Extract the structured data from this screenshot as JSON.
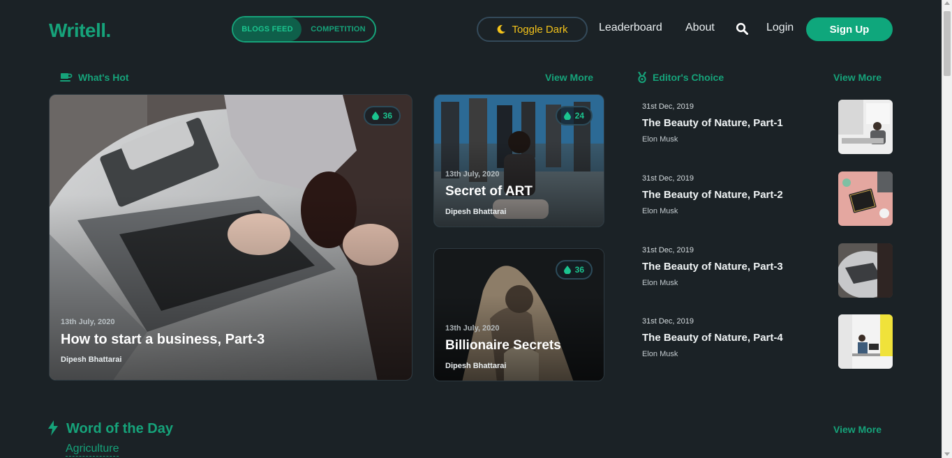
{
  "header": {
    "logo": "Writell.",
    "feed_tabs": [
      "BLOGS FEED",
      "COMPETITION"
    ],
    "toggle_dark": "Toggle Dark",
    "nav": [
      "Leaderboard",
      "About"
    ],
    "login": "Login",
    "signup": "Sign Up"
  },
  "whats_hot": {
    "heading": "What's Hot",
    "view_more": "View More",
    "cards": [
      {
        "date": "13th July, 2020",
        "title": "How to start a business, Part-3",
        "author": "Dipesh Bhattarai",
        "count": "36"
      },
      {
        "date": "13th July, 2020",
        "title": "Secret of ART",
        "author": "Dipesh Bhattarai",
        "count": "24"
      },
      {
        "date": "13th July, 2020",
        "title": "Billionaire Secrets",
        "author": "Dipesh Bhattarai",
        "count": "36"
      }
    ]
  },
  "editors_choice": {
    "heading": "Editor's Choice",
    "view_more": "View More",
    "items": [
      {
        "date": "31st Dec, 2019",
        "title": "The Beauty of Nature, Part-1",
        "author": "Elon Musk"
      },
      {
        "date": "31st Dec, 2019",
        "title": "The Beauty of Nature, Part-2",
        "author": "Elon Musk"
      },
      {
        "date": "31st Dec, 2019",
        "title": "The Beauty of Nature, Part-3",
        "author": "Elon Musk"
      },
      {
        "date": "31st Dec, 2019",
        "title": "The Beauty of Nature, Part-4",
        "author": "Elon Musk"
      }
    ]
  },
  "word_of_day": {
    "heading": "Word of the Day",
    "word": "Agriculture",
    "view_more": "View More"
  },
  "colors": {
    "background": "#1b2226",
    "accent": "#16a37a",
    "toggle_text": "#f2c21a"
  }
}
